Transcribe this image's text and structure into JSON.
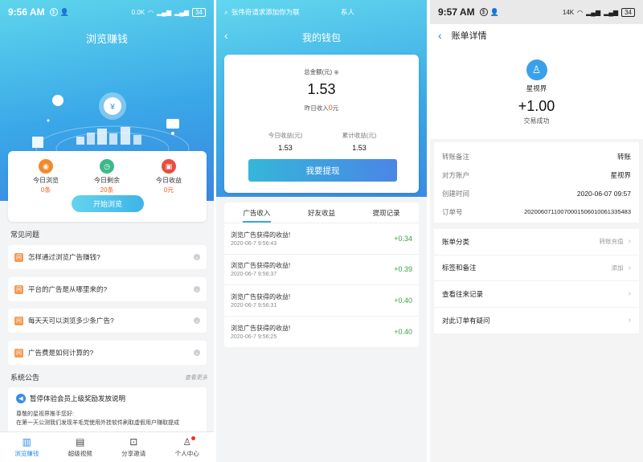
{
  "panel1": {
    "status": {
      "time": "9:56 AM",
      "net": "0.0K",
      "battery": "34"
    },
    "title": "浏览赚钱",
    "stats": [
      {
        "label": "今日浏览",
        "value": "0条",
        "color": "#f28a2c",
        "icon": "eye-icon"
      },
      {
        "label": "今日剩余",
        "value": "20条",
        "color": "#3bb98a",
        "icon": "clock-icon"
      },
      {
        "label": "今日收益",
        "value": "0元",
        "color": "#ea4d3d",
        "icon": "wallet-icon"
      }
    ],
    "start_button": "开始浏览",
    "faq_title": "常见问题",
    "faq_icon_glyph": "问",
    "faqs": [
      "怎样通过浏览广告赚钱?",
      "平台的广告是从哪里来的?",
      "每天天可以浏览多少条广告?",
      "广告费是如何计算的?"
    ],
    "notice_title": "系统公告",
    "notice_more": "查看更多",
    "notice": {
      "headline": "暂停体验会员上级奖励发放说明",
      "line1": "尊敬的星视界推手您好:",
      "line2": "在第一天公测我们发现羊毛党使用外挂软件刷取虚假用户赚取提成"
    },
    "tabs": [
      {
        "label": "浏览赚钱",
        "icon": "book-icon",
        "active": true
      },
      {
        "label": "超级视频",
        "icon": "film-icon",
        "active": false
      },
      {
        "label": "分享邀请",
        "icon": "share-icon",
        "active": false
      },
      {
        "label": "个人中心",
        "icon": "person-icon",
        "active": false
      }
    ]
  },
  "panel2": {
    "topbar_text": "张伟奇请求添加你为联",
    "topbar_contact": "系人",
    "title": "我的钱包",
    "total_label": "总金额(元)",
    "total": "1.53",
    "yesterday_label": "昨日收入",
    "yesterday_value": "0",
    "yesterday_unit": "元",
    "today_label": "今日收益(元)",
    "today_value": "1.53",
    "cumulative_label": "累计收益(元)",
    "cumulative_value": "1.53",
    "withdraw": "我要提现",
    "tabs": [
      "广告收入",
      "好友收益",
      "提现记录"
    ],
    "records": [
      {
        "title": "浏览广告获得的收益!",
        "date": "2020-06-7 9:56:43",
        "amount": "+0.34"
      },
      {
        "title": "浏览广告获得的收益!",
        "date": "2020-06-7 9:56:37",
        "amount": "+0.39"
      },
      {
        "title": "浏览广告获得的收益!",
        "date": "2020-06-7 9:56:31",
        "amount": "+0.40"
      },
      {
        "title": "浏览广告获得的收益!",
        "date": "2020-06-7 9:56:25",
        "amount": "+0.40"
      }
    ]
  },
  "panel3": {
    "status": {
      "time": "9:57 AM",
      "net": "14K",
      "battery": "34"
    },
    "title": "账单详情",
    "name": "星视界",
    "amount": "+1.00",
    "state": "交易成功",
    "info": [
      {
        "k": "转账备注",
        "v": "转账"
      },
      {
        "k": "对方账户",
        "v": "星视界"
      },
      {
        "k": "创建时间",
        "v": "2020-06-07 09:57"
      },
      {
        "k": "订单号",
        "v": "2020060711007000150601006133548​3"
      }
    ],
    "menu": [
      {
        "label": "账单分类",
        "sub": "转账充值"
      },
      {
        "label": "标签和备注",
        "sub": "添加"
      },
      {
        "label": "查看往来记录",
        "sub": ""
      },
      {
        "label": "对此订单有疑问",
        "sub": ""
      }
    ]
  }
}
